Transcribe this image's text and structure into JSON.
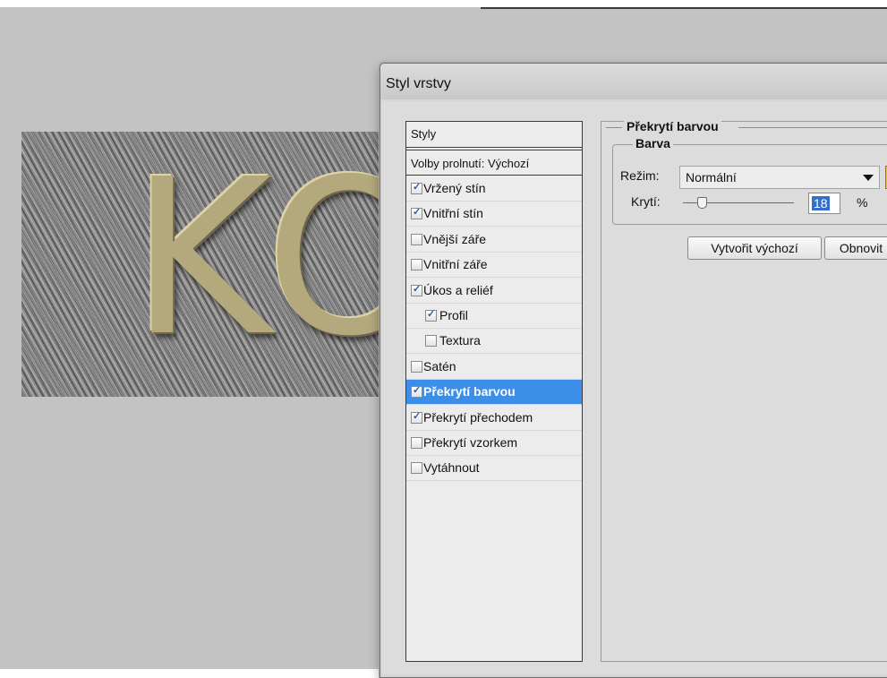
{
  "canvas": {
    "text": "KO"
  },
  "dialog": {
    "title": "Styl vrstvy"
  },
  "styles_panel": {
    "header": "Styly",
    "blending_options": "Volby prolnutí: Výchozí",
    "items": [
      {
        "label": "Vržený stín",
        "checked": true,
        "indent": false,
        "selected": false
      },
      {
        "label": "Vnitřní stín",
        "checked": true,
        "indent": false,
        "selected": false
      },
      {
        "label": "Vnější záře",
        "checked": false,
        "indent": false,
        "selected": false
      },
      {
        "label": "Vnitřní záře",
        "checked": false,
        "indent": false,
        "selected": false
      },
      {
        "label": "Úkos a reliéf",
        "checked": true,
        "indent": false,
        "selected": false
      },
      {
        "label": "Profil",
        "checked": true,
        "indent": true,
        "selected": false
      },
      {
        "label": "Textura",
        "checked": false,
        "indent": true,
        "selected": false
      },
      {
        "label": "Satén",
        "checked": false,
        "indent": false,
        "selected": false
      },
      {
        "label": "Překrytí barvou",
        "checked": true,
        "indent": false,
        "selected": true
      },
      {
        "label": "Překrytí přechodem",
        "checked": true,
        "indent": false,
        "selected": false
      },
      {
        "label": "Překrytí vzorkem",
        "checked": false,
        "indent": false,
        "selected": false
      },
      {
        "label": "Vytáhnout",
        "checked": false,
        "indent": false,
        "selected": false
      }
    ]
  },
  "color_overlay": {
    "section_title": "Překrytí barvou",
    "subsection_title": "Barva",
    "mode_label": "Režim:",
    "mode_value": "Normální",
    "swatch_color": "#e8c43a",
    "opacity_label": "Krytí:",
    "opacity_value": "18",
    "opacity_unit": "%",
    "make_default_button": "Vytvořit výchozí",
    "reset_button": "Obnovit"
  },
  "colors": {
    "selected_row": "#3d8ee8",
    "canvas_bg": "#c3c3c3"
  }
}
